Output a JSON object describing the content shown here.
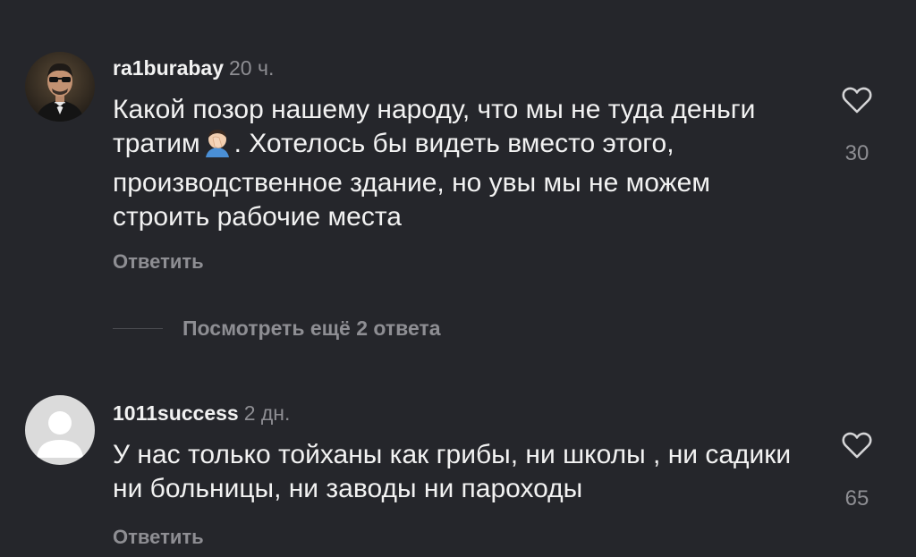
{
  "comments": [
    {
      "username": "ra1burabay",
      "time": "20 ч.",
      "text_before_emoji": "Какой позор нашему народу, что мы не туда деньги тратим",
      "emoji": "person-facepalming",
      "text_after_emoji": ". Хотелось бы видеть вместо этого, производственное здание, но увы мы не можем строить рабочие места",
      "reply_label": "Ответить",
      "like_count": "30"
    },
    {
      "username": "1011success",
      "time": "2 дн.",
      "text": "У нас только тойханы как грибы, ни школы , ни садики ни больницы, ни заводы ни пароходы",
      "reply_label": "Ответить",
      "like_count": "65"
    }
  ],
  "view_more_replies": "Посмотреть ещё 2 ответа",
  "colors": {
    "background": "#25262b",
    "text": "#f2f2f2",
    "secondary": "#8e8e93"
  }
}
